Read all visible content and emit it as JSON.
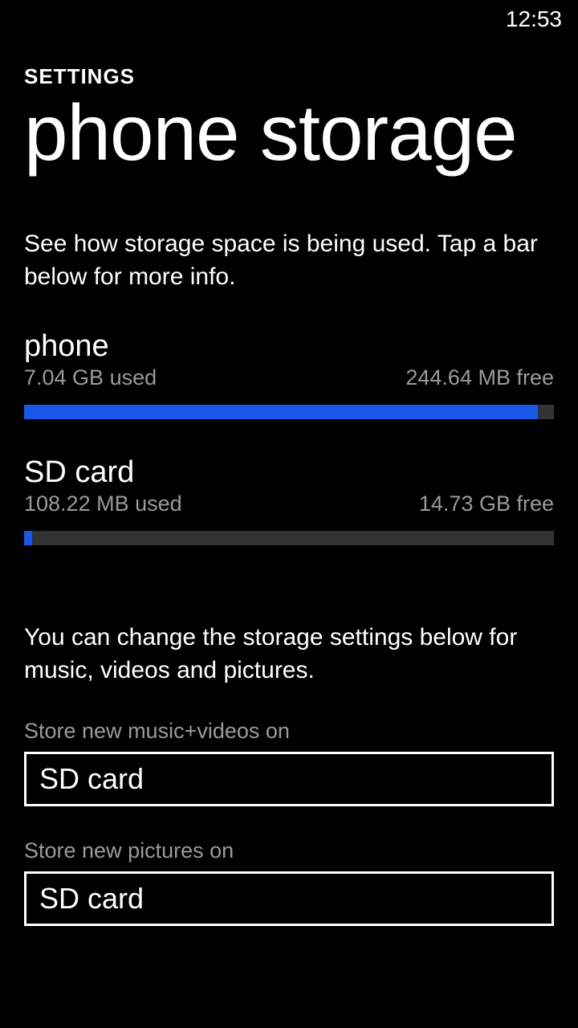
{
  "status": {
    "time": "12:53"
  },
  "header": {
    "breadcrumb": "SETTINGS",
    "title": "phone storage"
  },
  "description": "See how storage space is being used. Tap a bar below for more info.",
  "storage": {
    "phone": {
      "label": "phone",
      "used": "7.04 GB used",
      "free": "244.64 MB free",
      "fill_percent": 97
    },
    "sdcard": {
      "label": "SD card",
      "used": "108.22 MB used",
      "free": "14.73 GB free",
      "fill_percent": 1.5
    }
  },
  "settings_description": "You can change the storage settings below for music, videos and pictures.",
  "selects": {
    "music_videos": {
      "label": "Store new music+videos on",
      "value": "SD card"
    },
    "pictures": {
      "label": "Store new pictures on",
      "value": "SD card"
    }
  }
}
